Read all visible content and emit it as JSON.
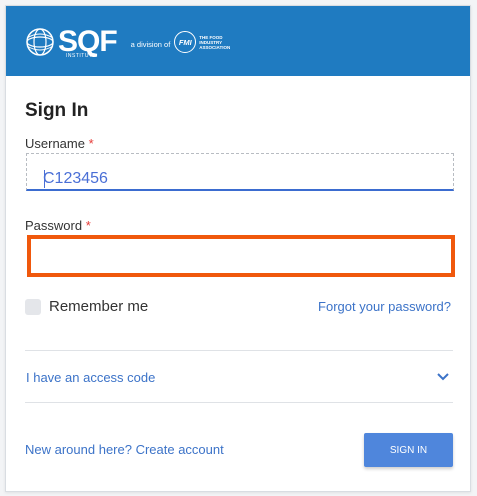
{
  "header": {
    "brand": "SQF",
    "brand_sub": "INSTITUTE",
    "division_text": "a division of",
    "partner_short": "FMI",
    "partner_name": "THE FOOD INDUSTRY ASSOCIATION",
    "background": "#1f7bc1"
  },
  "form": {
    "title": "Sign In",
    "username_label": "Username",
    "username_value": "C123456",
    "password_label": "Password",
    "required_mark": "*",
    "remember_label": "Remember me",
    "forgot_link": "Forgot your password?",
    "access_code_label": "I have an access code",
    "create_account_link": "New around here? Create account",
    "signin_button": "SIGN IN"
  },
  "colors": {
    "accent": "#3c73c8",
    "button": "#4f86dc",
    "focus_outline": "#f0580c",
    "required": "#e53935"
  },
  "icons": {
    "globe": "globe-icon",
    "chevron": "chevron-down-icon"
  }
}
